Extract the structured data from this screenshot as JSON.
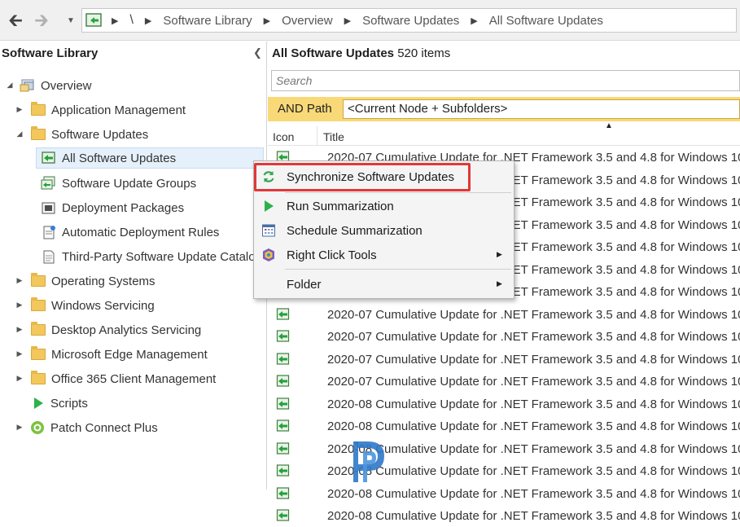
{
  "address_bar": {
    "root_label": "\\",
    "breadcrumbs": [
      "Software Library",
      "Overview",
      "Software Updates",
      "All Software Updates"
    ]
  },
  "left_pane": {
    "title": "Software Library",
    "tree": [
      {
        "label": "Overview",
        "icon": "overview-icon"
      },
      {
        "label": "Application Management",
        "icon": "folder-icon"
      },
      {
        "label": "Software Updates",
        "icon": "folder-icon"
      },
      {
        "label": "All Software Updates",
        "icon": "software-update-icon"
      },
      {
        "label": "Software Update Groups",
        "icon": "update-group-icon"
      },
      {
        "label": "Deployment Packages",
        "icon": "package-icon"
      },
      {
        "label": "Automatic Deployment Rules",
        "icon": "rule-icon"
      },
      {
        "label": "Third-Party Software Update Catalo",
        "icon": "catalog-icon"
      },
      {
        "label": "Operating Systems",
        "icon": "folder-icon"
      },
      {
        "label": "Windows Servicing",
        "icon": "folder-icon"
      },
      {
        "label": "Desktop Analytics Servicing",
        "icon": "folder-icon"
      },
      {
        "label": "Microsoft Edge Management",
        "icon": "folder-icon"
      },
      {
        "label": "Office 365 Client Management",
        "icon": "folder-icon"
      },
      {
        "label": "Scripts",
        "icon": "scripts-icon"
      },
      {
        "label": "Patch Connect Plus",
        "icon": "patch-connect-icon"
      }
    ]
  },
  "right_pane": {
    "title": "All Software Updates",
    "item_count": "520 items",
    "search_placeholder": "Search",
    "filter_label": "AND Path",
    "filter_value": "<Current Node + Subfolders>",
    "columns": [
      "Icon",
      "Title"
    ],
    "rows": [
      "2020-07 Cumulative Update for .NET Framework 3.5 and 4.8 for Windows 10",
      "2020-07 Cumulative Update for .NET Framework 3.5 and 4.8 for Windows 10",
      "2020-07 Cumulative Update for .NET Framework 3.5 and 4.8 for Windows 10",
      "2020-07 Cumulative Update for .NET Framework 3.5 and 4.8 for Windows 10",
      "2020-07 Cumulative Update for .NET Framework 3.5 and 4.8 for Windows 10",
      "2020-07 Cumulative Update for .NET Framework 3.5 and 4.8 for Windows 10",
      "2020-07 Cumulative Update for .NET Framework 3.5 and 4.8 for Windows 10",
      "2020-07 Cumulative Update for .NET Framework 3.5 and 4.8 for Windows 10",
      "2020-07 Cumulative Update for .NET Framework 3.5 and 4.8 for Windows 10",
      "2020-07 Cumulative Update for .NET Framework 3.5 and 4.8 for Windows 10",
      "2020-07 Cumulative Update for .NET Framework 3.5 and 4.8 for Windows 10",
      "2020-08 Cumulative Update for .NET Framework 3.5 and 4.8 for Windows 10",
      "2020-08 Cumulative Update for .NET Framework 3.5 and 4.8 for Windows 10",
      "2020-08 Cumulative Update for .NET Framework 3.5 and 4.8 for Windows 10",
      "2020-08 Cumulative Update for .NET Framework 3.5 and 4.8 for Windows 10",
      "2020-08 Cumulative Update for .NET Framework 3.5 and 4.8 for Windows 10",
      "2020-08 Cumulative Update for .NET Framework 3.5 and 4.8 for Windows 10"
    ]
  },
  "context_menu": {
    "items": [
      {
        "label": "Synchronize Software Updates",
        "icon": "sync-icon",
        "submenu": false
      },
      {
        "label": "Run Summarization",
        "icon": "run-icon",
        "submenu": false
      },
      {
        "label": "Schedule Summarization",
        "icon": "schedule-icon",
        "submenu": false
      },
      {
        "label": "Right Click Tools",
        "icon": "right-click-tools-icon",
        "submenu": true
      },
      {
        "label": "Folder",
        "icon": "",
        "submenu": true
      }
    ]
  },
  "colors": {
    "filter_bar": "#f9d977",
    "highlight": "#e13838",
    "selection": "#e5f0fb"
  }
}
